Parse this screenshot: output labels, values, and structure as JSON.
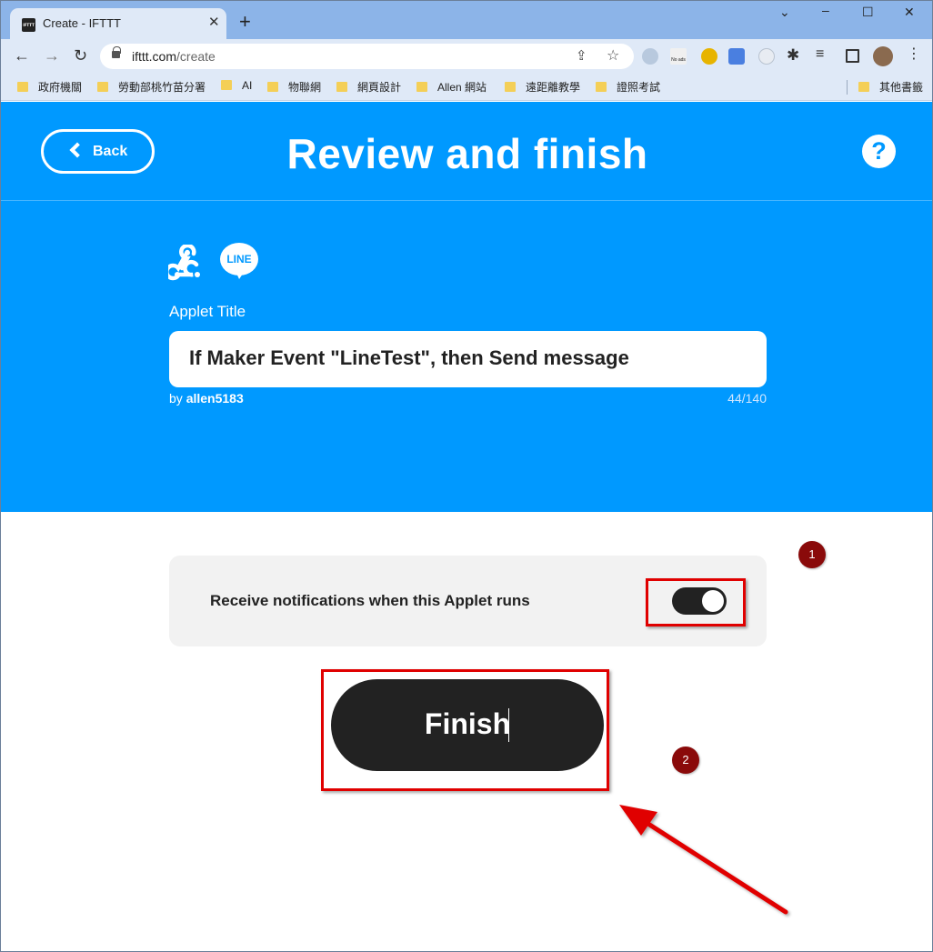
{
  "browser": {
    "tab_title": "Create - IFTTT",
    "tab_favicon_text": "IFTTT",
    "url_host": "ifttt.com",
    "url_path": "/create",
    "bookmarks": [
      "政府機關",
      "勞動部桃竹苗分署",
      "AI",
      "物聯網",
      "網頁設計",
      "Allen 網站",
      "遠距離教學",
      "證照考試"
    ],
    "other_bookmarks": "其他書籤",
    "ext_no_ads_label": "No ads"
  },
  "header": {
    "back_label": "Back",
    "title": "Review and finish",
    "help_label": "?"
  },
  "applet": {
    "services": [
      "webhooks-icon",
      "line-icon"
    ],
    "line_text": "LINE",
    "title_label": "Applet Title",
    "title_value": "If Maker Event \"LineTest\", then Send message",
    "by_prefix": "by",
    "author": "allen5183",
    "char_count": "44/140"
  },
  "notifications": {
    "label": "Receive notifications when this Applet runs",
    "enabled": true
  },
  "finish": {
    "label": "Finish"
  },
  "annotations": {
    "badge_1": "1",
    "badge_2": "2",
    "highlight_color": "#e00000",
    "badge_color": "#8a0a0a"
  },
  "colors": {
    "ifttt_blue": "#0099ff",
    "dark": "#222222"
  }
}
